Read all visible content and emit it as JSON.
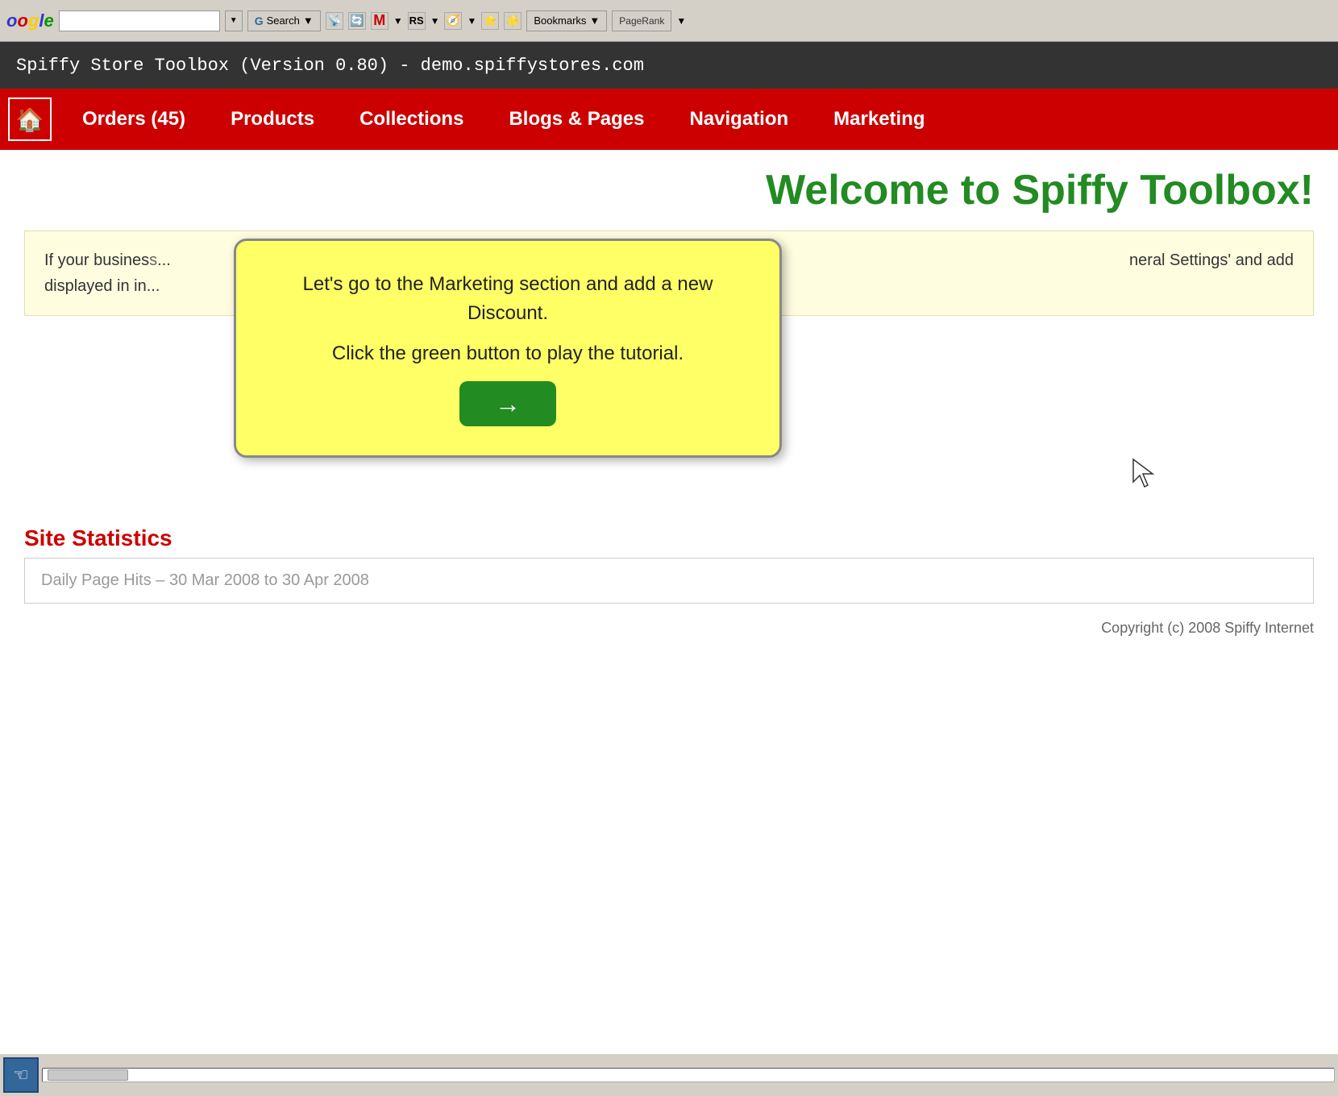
{
  "browser": {
    "google_label": "ogle",
    "search_placeholder": "",
    "search_btn": "Search",
    "bookmarks_btn": "Bookmarks",
    "pagerank_label": "PageRank"
  },
  "titlebar": {
    "text": "Spiffy Store Toolbox (Version 0.80) - demo.spiffystores.com"
  },
  "navbar": {
    "home_icon": "🏠",
    "items": [
      {
        "label": "Orders (45)"
      },
      {
        "label": "Products"
      },
      {
        "label": "Collections"
      },
      {
        "label": "Blogs & Pages"
      },
      {
        "label": "Navigation"
      },
      {
        "label": "Marketing"
      }
    ]
  },
  "main": {
    "welcome_title": "Welcome to Spiffy Toolbox!",
    "info_text_start": "If your busines",
    "info_text_end": "neral Settings' and add",
    "info_text_middle": "displayed in in"
  },
  "tooltip": {
    "line1": "Let's go to the Marketing section and add a new Discount.",
    "line2": "Click the green button to play the tutorial.",
    "btn_arrow": "→"
  },
  "stats": {
    "header": "Site Statistics",
    "label": "Daily Page Hits – 30 Mar 2008 to 30 Apr 2008"
  },
  "footer": {
    "copyright": "Copyright (c) 2008 Spiffy Internet"
  }
}
